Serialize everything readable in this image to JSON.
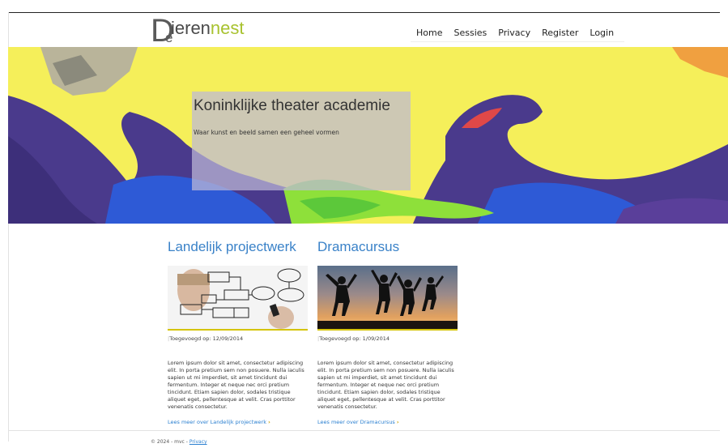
{
  "logo": {
    "letter_d": "D",
    "letter_e": "e",
    "word_part1": "ieren",
    "word_part2": "nest"
  },
  "nav": {
    "items": [
      "Home",
      "Sessies",
      "Privacy",
      "Register",
      "Login"
    ]
  },
  "hero": {
    "title": "Koninklijke theater academie",
    "subtitle": "Waar kunst en beeld samen een geheel vormen"
  },
  "articles": [
    {
      "title": "Landelijk projectwerk",
      "image": "flowchart-drawing-image",
      "date_label": "Toegevoegd op: 12/09/2014",
      "body": "Lorem ipsum dolor sit amet, consectetur adipiscing elit. In porta pretium sem non posuere. Nulla iaculis sapien ut mi imperdiet, sit amet tincidunt dui fermentum. Integer et neque nec orci pretium tincidunt. Etiam sapien dolor, sodales tristique aliquet eget, pellentesque at velit. Cras porttitor venenatis consectetur.",
      "link": "Lees meer over Landelijk projectwerk",
      "link_chevron": "›"
    },
    {
      "title": "Dramacursus",
      "image": "jumping-silhouettes-image",
      "date_label": "Toegevoegd op: 1/09/2014",
      "body": "Lorem ipsum dolor sit amet, consectetur adipiscing elit. In porta pretium sem non posuere. Nulla iaculis sapien ut mi imperdiet, sit amet tincidunt dui fermentum. Integer et neque nec orci pretium tincidunt. Etiam sapien dolor, sodales tristique aliquet eget, pellentesque at velit. Cras porttitor venenatis consectetur.",
      "link": "Lees meer over Dramacursus",
      "link_chevron": "›"
    }
  ],
  "footer": {
    "text": "© 2024 - mvc - ",
    "privacy_link": "Privacy"
  },
  "colors": {
    "accent": "#3a82c8",
    "logo_green": "#a8c22f",
    "rule_yellow": "#d5c400"
  }
}
